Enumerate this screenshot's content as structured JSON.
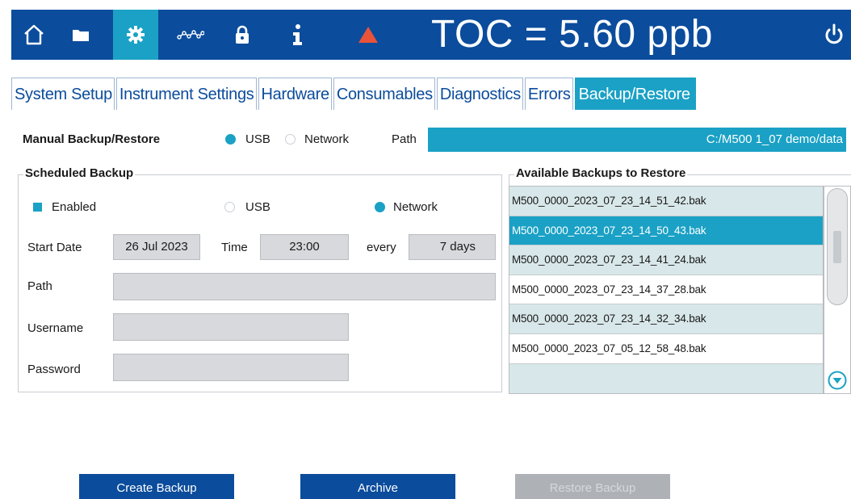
{
  "topbar": {
    "toc_label": "TOC = 5.60 ppb",
    "bg_color": "#0b4c9c",
    "active_color": "#1aa1c5",
    "alarm_color": "#e8533a",
    "icons": [
      "home-icon",
      "folder-icon",
      "gear-icon",
      "trend-icon",
      "lock-icon",
      "info-icon",
      "alarm-icon",
      "power-icon"
    ]
  },
  "tabs": [
    {
      "label": "System Setup"
    },
    {
      "label": "Instrument Settings"
    },
    {
      "label": "Hardware"
    },
    {
      "label": "Consumables"
    },
    {
      "label": "Diagnostics"
    },
    {
      "label": "Errors"
    },
    {
      "label": "Backup/Restore",
      "active": true
    }
  ],
  "manual": {
    "title": "Manual Backup/Restore",
    "usb_label": "USB",
    "network_label": "Network",
    "selected": "USB",
    "path_label": "Path",
    "path_value": "C:/M500 1_07 demo/data"
  },
  "scheduled": {
    "title": "Scheduled Backup",
    "enabled_label": "Enabled",
    "enabled": true,
    "usb_label": "USB",
    "network_label": "Network",
    "selected": "Network",
    "start_date_label": "Start Date",
    "start_date_value": "26 Jul 2023",
    "time_label": "Time",
    "time_value": "23:00",
    "every_label": "every",
    "every_value": "7 days",
    "path_label": "Path",
    "path_value": "",
    "username_label": "Username",
    "username_value": "",
    "password_label": "Password",
    "password_value": ""
  },
  "backups": {
    "title": "Available Backups to Restore",
    "items": [
      "M500_0000_2023_07_23_14_51_42.bak",
      "M500_0000_2023_07_23_14_50_43.bak",
      "M500_0000_2023_07_23_14_41_24.bak",
      "M500_0000_2023_07_23_14_37_28.bak",
      "M500_0000_2023_07_23_14_32_34.bak",
      "M500_0000_2023_07_05_12_58_48.bak",
      ""
    ],
    "selected_index": 1
  },
  "buttons": {
    "create_backup": "Create Backup",
    "archive": "Archive",
    "restore_backup": "Restore Backup"
  }
}
